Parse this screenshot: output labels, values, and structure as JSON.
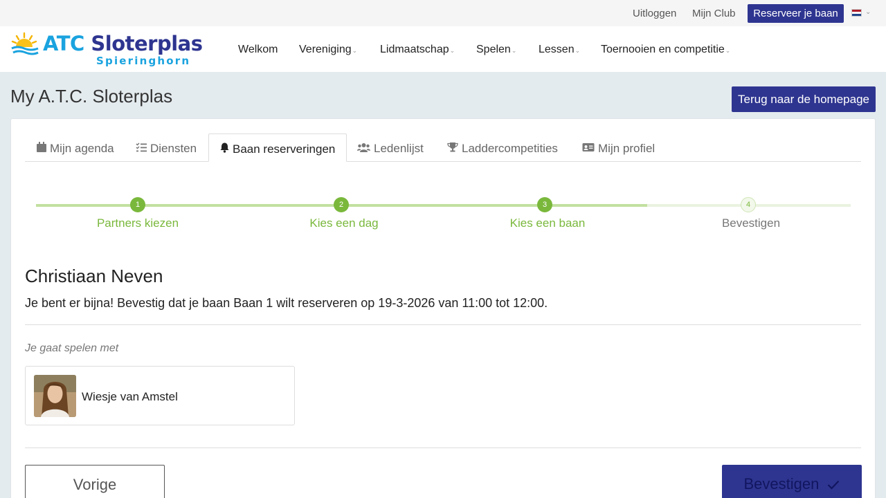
{
  "topbar": {
    "logout": "Uitloggen",
    "my_club": "Mijn Club",
    "reserve_button": "Reserveer je baan",
    "language_flag": "flag-netherlands-icon"
  },
  "logo": {
    "title_part1": "ATC",
    "title_part2": "Sloterplas",
    "subtitle": "Spieringhorn"
  },
  "nav": {
    "items": [
      {
        "label": "Welkom"
      },
      {
        "label": "Vereniging"
      },
      {
        "label": "Lidmaatschap"
      },
      {
        "label": "Spelen"
      },
      {
        "label": "Lessen"
      },
      {
        "label": "Toernooien en competitie"
      }
    ]
  },
  "page": {
    "title": "My A.T.C. Sloterplas",
    "home_button": "Terug naar de homepage"
  },
  "tabs": [
    {
      "label": "Mijn agenda",
      "icon": "calendar-icon"
    },
    {
      "label": "Diensten",
      "icon": "checklist-icon"
    },
    {
      "label": "Baan reserveringen",
      "icon": "bell-icon",
      "active": true
    },
    {
      "label": "Ledenlijst",
      "icon": "users-icon"
    },
    {
      "label": "Laddercompetities",
      "icon": "trophy-icon"
    },
    {
      "label": "Mijn profiel",
      "icon": "id-card-icon"
    }
  ],
  "stepper": {
    "steps": [
      {
        "number": "1",
        "label": "Partners kiezen"
      },
      {
        "number": "2",
        "label": "Kies een dag"
      },
      {
        "number": "3",
        "label": "Kies een baan"
      },
      {
        "number": "4",
        "label": "Bevestigen"
      }
    ],
    "completed": 3,
    "colors": {
      "done": "#7ab83c",
      "track": "#c2e0a0",
      "pending_track": "#eaf2e0"
    }
  },
  "reservation": {
    "member_name": "Christiaan Neven",
    "confirm_text": "Je bent er bijna! Bevestig dat je baan Baan 1 wilt reserveren op 19-3-2026 van 11:00 tot 12:00.",
    "playing_with_label": "Je gaat spelen met",
    "partner_name": "Wiesje van Amstel"
  },
  "actions": {
    "previous": "Vorige",
    "confirm": "Bevestigen",
    "confirm_icon": "check-icon"
  },
  "colors": {
    "brand_blue": "#2e3590",
    "brand_cyan": "#1aa3df",
    "step_green": "#7ab83c"
  }
}
